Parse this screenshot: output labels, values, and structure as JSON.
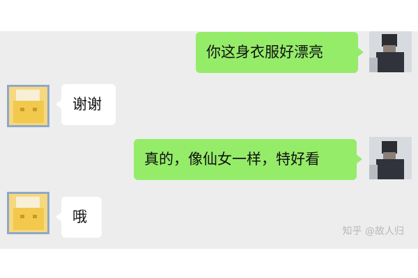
{
  "messages": [
    {
      "side": "right",
      "text": "你这身衣服好漂亮"
    },
    {
      "side": "left",
      "text": "谢谢"
    },
    {
      "side": "right",
      "text": "真的，像仙女一样，特好看"
    },
    {
      "side": "left",
      "text": "哦"
    }
  ],
  "watermark": "知乎 @故人归",
  "colors": {
    "chat_background": "#ededed",
    "outgoing_bubble": "#95ec69",
    "incoming_bubble": "#ffffff",
    "text": "#111111"
  },
  "icons": {
    "self_avatar": "pixelated-person-avatar",
    "other_avatar": "pixelated-cartoon-avatar"
  }
}
